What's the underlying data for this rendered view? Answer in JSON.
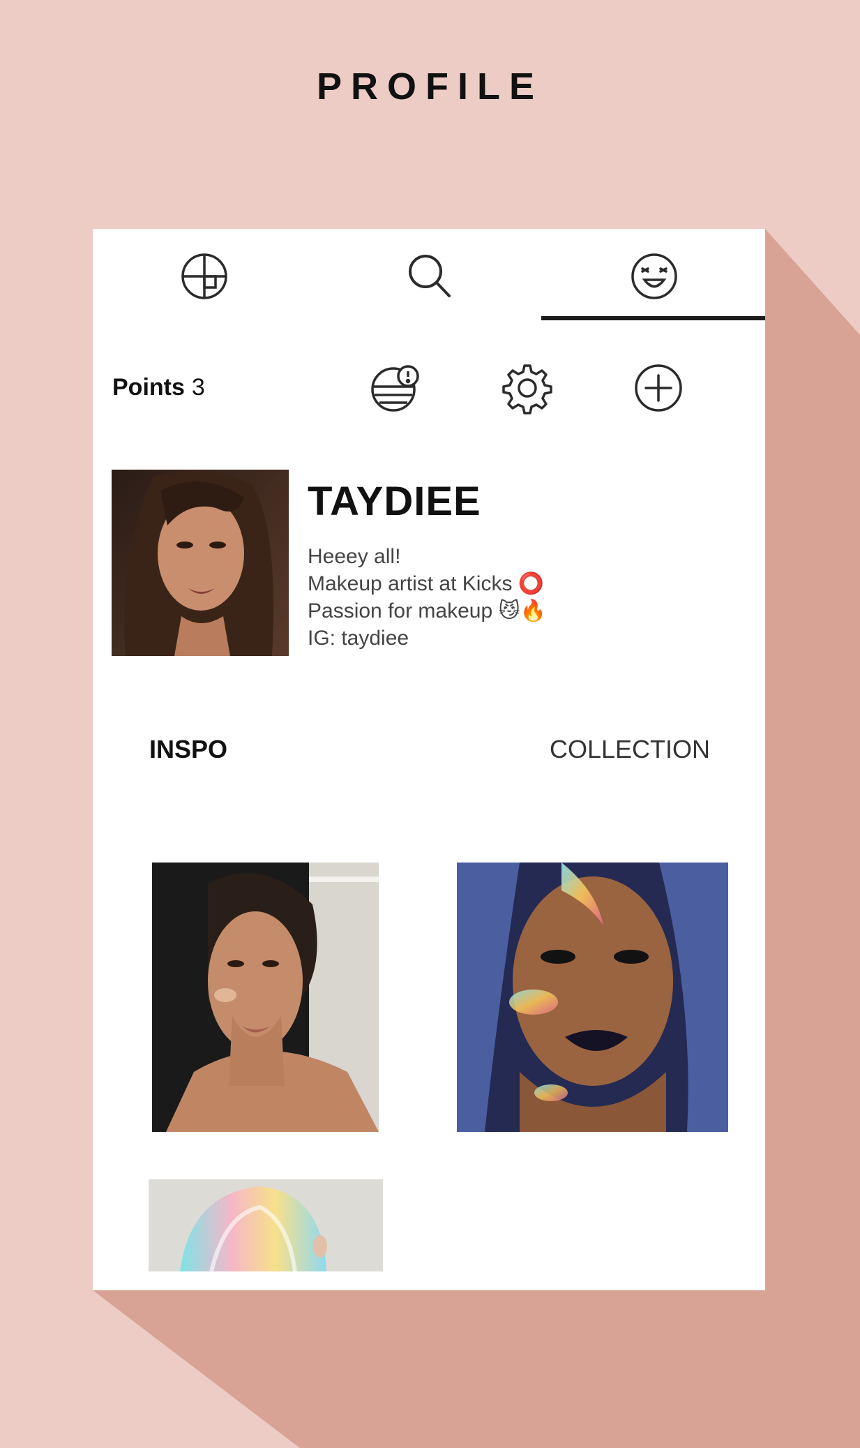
{
  "page": {
    "title": "PROFILE"
  },
  "nav": {
    "items": [
      {
        "icon": "grid-circle-icon",
        "active": false
      },
      {
        "icon": "search-icon",
        "active": false
      },
      {
        "icon": "face-icon",
        "active": true
      }
    ]
  },
  "profile": {
    "points_label": "Points",
    "points_value": "3",
    "username": "TAYDIEE",
    "bio": [
      "Heeey all!",
      "Makeup artist at Kicks ⭕",
      "Passion for makeup 😼🔥",
      "IG: taydiee"
    ]
  },
  "actions": [
    {
      "icon": "palette-badge-icon"
    },
    {
      "icon": "gear-icon"
    },
    {
      "icon": "add-icon"
    }
  ],
  "tabs": {
    "inspo": "INSPO",
    "collection": "COLLECTION",
    "selected": "INSPO"
  },
  "colors": {
    "background": "#ecccc4",
    "shadow": "#d8a395",
    "card": "#ffffff",
    "text": "#111111"
  }
}
